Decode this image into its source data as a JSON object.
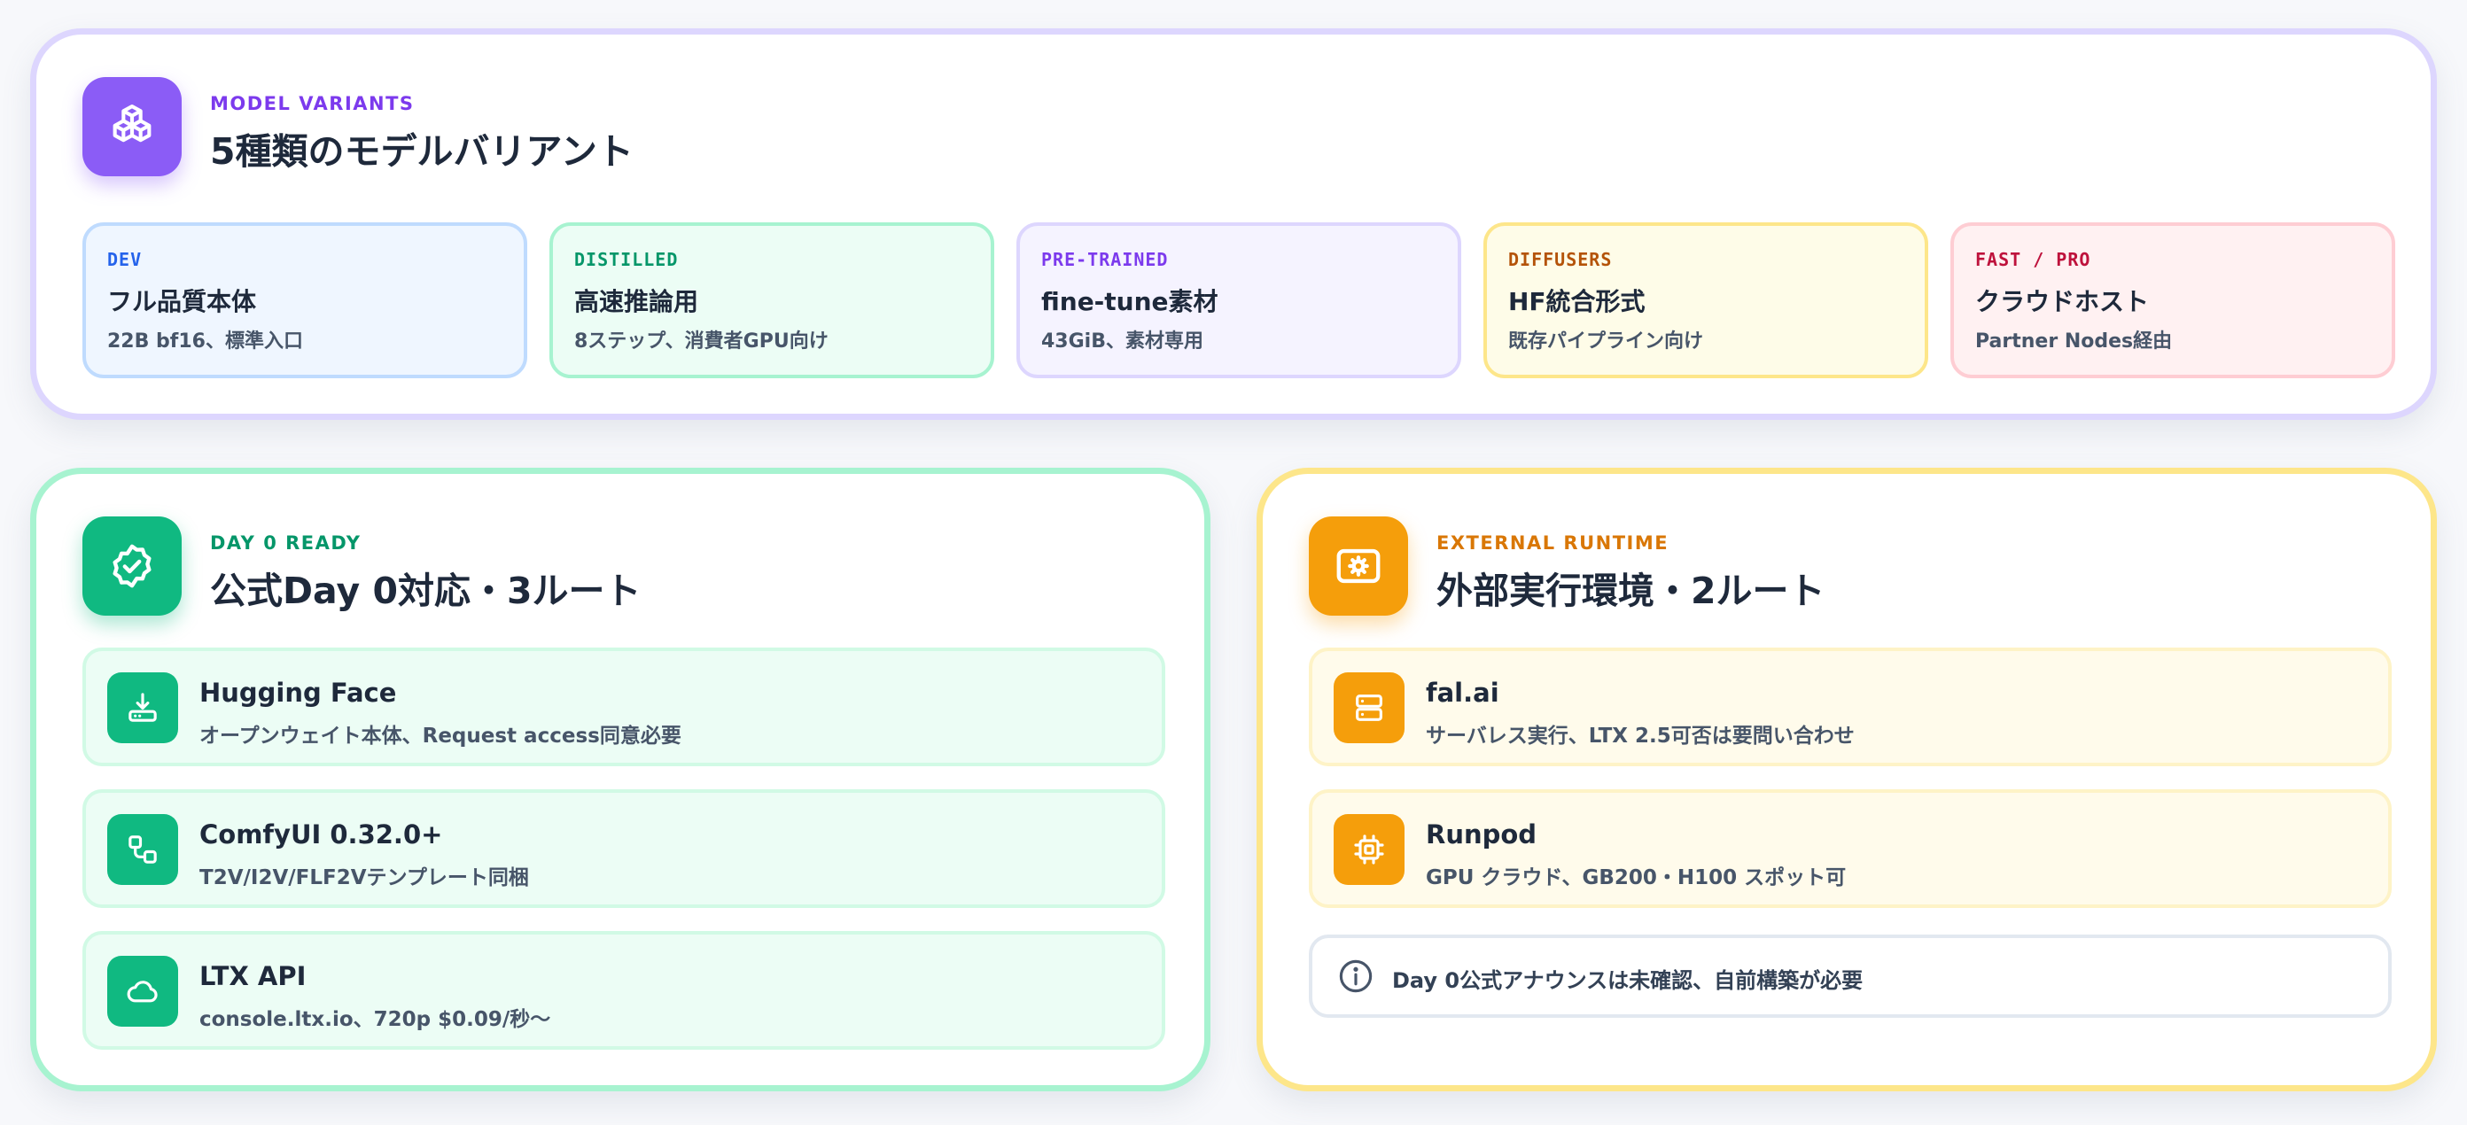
{
  "variants_card": {
    "eyebrow": "MODEL VARIANTS",
    "title": "5種類のモデルバリアント",
    "icon": "cubes-icon",
    "items": [
      {
        "tag": "DEV",
        "title": "フル品質本体",
        "subtitle": "22B bf16、標準入口",
        "accent": "#2563eb"
      },
      {
        "tag": "DISTILLED",
        "title": "高速推論用",
        "subtitle": "8ステップ、消費者GPU向け",
        "accent": "#059669"
      },
      {
        "tag": "PRE-TRAINED",
        "title": "fine-tune素材",
        "subtitle": "43GiB、素材専用",
        "accent": "#7c3aed"
      },
      {
        "tag": "DIFFUSERS",
        "title": "HF統合形式",
        "subtitle": "既存パイプライン向け",
        "accent": "#b45309"
      },
      {
        "tag": "FAST / PRO",
        "title": "クラウドホスト",
        "subtitle": "Partner Nodes経由",
        "accent": "#be123c"
      }
    ]
  },
  "day0_card": {
    "eyebrow": "DAY 0 READY",
    "title": "公式Day 0対応・3ルート",
    "icon": "check-badge-icon",
    "routes": [
      {
        "title": "Hugging Face",
        "subtitle": "オープンウェイト本体、Request access同意必要",
        "icon": "download-drive-icon"
      },
      {
        "title": "ComfyUI 0.32.0+",
        "subtitle": "T2V/I2V/FLF2Vテンプレート同梱",
        "icon": "workflow-icon"
      },
      {
        "title": "LTX API",
        "subtitle": "console.ltx.io、720p $0.09/秒〜",
        "icon": "cloud-icon"
      }
    ]
  },
  "external_card": {
    "eyebrow": "EXTERNAL RUNTIME",
    "title": "外部実行環境・2ルート",
    "icon": "server-gear-icon",
    "routes": [
      {
        "title": "fal.ai",
        "subtitle": "サーバレス実行、LTX 2.5可否は要問い合わせ",
        "icon": "server-icon"
      },
      {
        "title": "Runpod",
        "subtitle": "GPU クラウド、GB200・H100 スポット可",
        "icon": "chip-icon"
      }
    ],
    "notice": {
      "text": "Day 0公式アナウンスは未確認、自前構築が必要",
      "icon": "info-icon"
    }
  },
  "colors": {
    "purple": "#8b5cf6",
    "green": "#10b981",
    "amber": "#f59e0b",
    "eyebrow_purple": "#7c3aed",
    "eyebrow_green": "#059669",
    "eyebrow_amber": "#d97706"
  }
}
